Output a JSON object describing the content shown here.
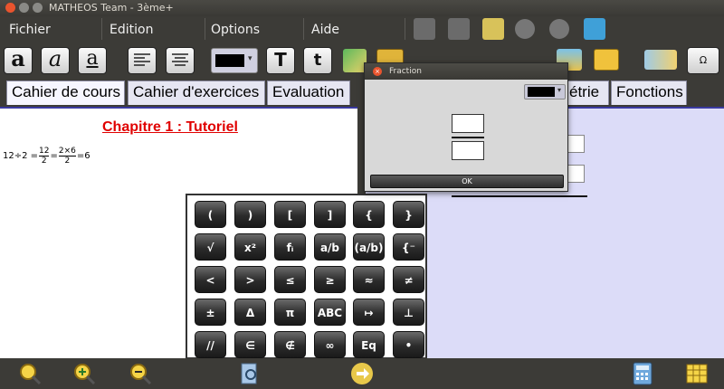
{
  "window": {
    "title": "MATHEOS Team - 3ème+"
  },
  "menu": {
    "items": [
      "Fichier",
      "Edition",
      "Options",
      "Aide"
    ]
  },
  "toolbar": {
    "font_a_serif": "a",
    "font_a_italic": "a",
    "font_a_underline": "a",
    "bold_T": "T",
    "plain_t": "t",
    "text_color": "#000000",
    "special_char_glyph": "Ω"
  },
  "tabs": {
    "left": [
      "Cahier de cours",
      "Cahier d'exercices",
      "Evaluation"
    ],
    "right": [
      "étrie",
      "Fonctions"
    ]
  },
  "document": {
    "chapter_title": "Chapitre 1 : Tutoriel",
    "formula": {
      "lhs": "12÷2 =",
      "f1_num": "12",
      "f1_den": "2",
      "eq1": "=",
      "f2_num": "2×6",
      "f2_den": "2",
      "rhs": "=6"
    }
  },
  "dialog": {
    "title": "Fraction",
    "close_glyph": "×",
    "color": "#000000",
    "ok_label": "OK"
  },
  "keypad": {
    "rows": [
      [
        "(",
        ")",
        "[",
        "]",
        "{",
        "}"
      ],
      [
        "√",
        "x²",
        "fᵢ",
        "a/b",
        "(a/b)",
        "{⁻"
      ],
      [
        "<",
        ">",
        "≤",
        "≥",
        "≈",
        "≠"
      ],
      [
        "±",
        "Δ",
        "π",
        "ABC",
        "↦",
        "⊥"
      ],
      [
        "//",
        "∈",
        "∉",
        "∞",
        "Eq",
        "•"
      ]
    ]
  },
  "colors": {
    "chrome": "#3c3b37",
    "tab_bg": "#e6e6f2",
    "right_pane": "#dcdcf8",
    "chapter_red": "#e00000"
  }
}
